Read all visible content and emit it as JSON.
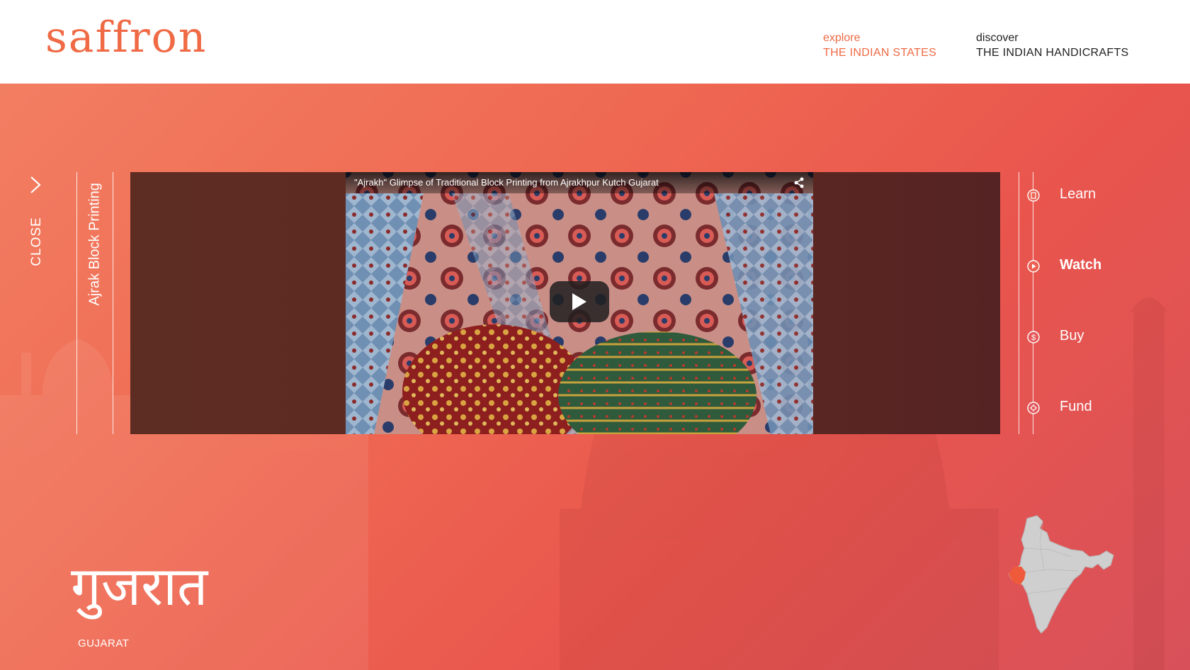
{
  "brand": {
    "logo_text": "saffron"
  },
  "nav": {
    "explore": {
      "small": "explore",
      "big": "THE INDIAN STATES"
    },
    "discover": {
      "small": "discover",
      "big": "THE INDIAN HANDICRAFTS"
    }
  },
  "close_label": "CLOSE",
  "craft_title": "Ajrak Block Printing",
  "video": {
    "title": "\"Ajrakh\" Glimpse of Traditional Block Printing from Ajrakhpur Kutch Gujarat"
  },
  "menu": [
    {
      "label": "Learn",
      "icon": "learn-icon",
      "active": false
    },
    {
      "label": "Watch",
      "icon": "play-circle-icon",
      "active": true
    },
    {
      "label": "Buy",
      "icon": "dollar-icon",
      "active": false
    },
    {
      "label": "Fund",
      "icon": "fund-icon",
      "active": false
    }
  ],
  "state": {
    "name_native": "गुजरात",
    "name_english": "GUJARAT"
  },
  "colors": {
    "accent": "#ef6a45",
    "hero_start": "#f27e62",
    "hero_end": "#d8515a",
    "video_panel": "#5d2c22",
    "map_fill": "#cfcfcf",
    "map_highlight": "#ef5a3a"
  }
}
